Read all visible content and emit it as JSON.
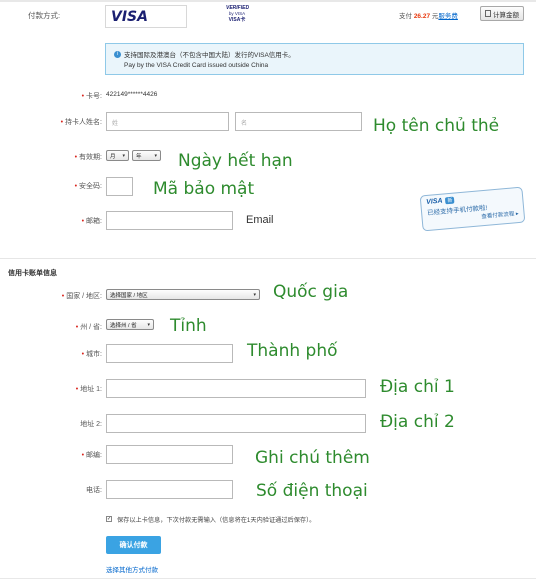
{
  "payment": {
    "label": "付款方式:",
    "visa_text": "VISA",
    "verified_line1": "VERIFIED",
    "verified_line2": "by VISA",
    "verified_line3": "VISA卡",
    "pay_prefix": "支付",
    "amount": "26.27",
    "currency": "元",
    "fee_link": "服务费",
    "calc_button": "计算金额"
  },
  "notice": {
    "line1": "支持国际及港澳台（不包含中国大陆）发行的VISA信用卡。",
    "line2": "Pay by the VISA Credit Card issued outside China"
  },
  "card": {
    "number_label": "卡号:",
    "number_value": "422149******4426",
    "holder_label": "持卡人姓名:",
    "last_name_placeholder": "姓",
    "first_name_placeholder": "名",
    "expiry_label": "有效期:",
    "month_value": "月",
    "year_value": "年",
    "cvv_label": "安全码:",
    "email_label": "邮箱:"
  },
  "mobile_badge": {
    "brand": "VISA",
    "tag": "新",
    "line1": "已经支持手机付款啦!",
    "line2": "查看付款流程 ▸"
  },
  "billing": {
    "section_title": "信用卡账单信息",
    "country_label": "国家 / 地区:",
    "country_value": "选择国家 / 地区",
    "state_label": "州 / 省:",
    "state_value": "选择州 / 省",
    "city_label": "城市:",
    "address1_label": "地址 1:",
    "address2_label": "地址 2:",
    "zip_label": "邮编:",
    "phone_label": "电话:",
    "save_text": "保存以上卡信息，下次付款无需输入（信息将在1天内验证通过后保存）。",
    "confirm_button": "确认付款",
    "other_methods_link": "选择其他方式付款"
  },
  "annotations": {
    "holder_name": "Họ tên chủ thẻ",
    "expiry": "Ngày hết hạn",
    "cvv": "Mã bảo mật",
    "email": "Email",
    "country": "Quốc gia",
    "state": "Tỉnh",
    "city": "Thành phố",
    "address1": "Địa chỉ 1",
    "address2": "Địa chỉ 2",
    "notes": "Ghi chú thêm",
    "phone": "Số điện thoại"
  },
  "colors": {
    "required": "#d9251d",
    "amount": "#e8380d",
    "link": "#0066cc",
    "notice_bg": "#eaf5fb",
    "notice_border": "#8fc9e8",
    "confirm_bg": "#3aa3e3",
    "annotation": "#2e8b2e"
  }
}
